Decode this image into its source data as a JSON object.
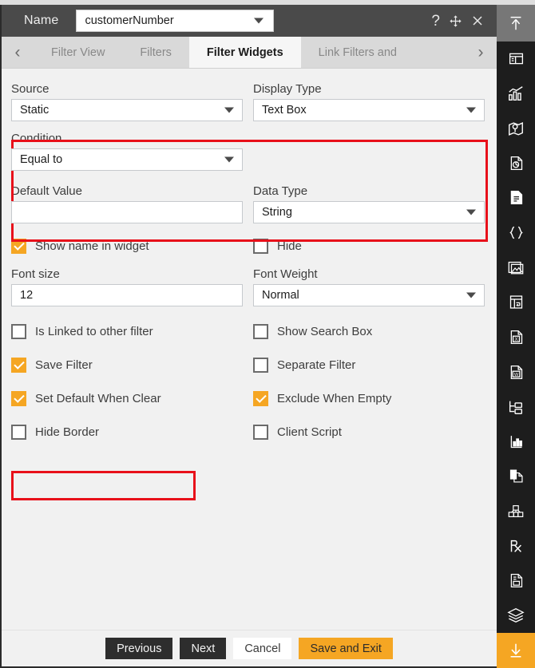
{
  "titlebar": {
    "name_label": "Name",
    "name_value": "customerNumber",
    "help_icon": "question-mark-icon",
    "move_icon": "move-cross-icon",
    "close_icon": "close-icon"
  },
  "tabbar": {
    "prev_arrow": "‹",
    "next_arrow": "›",
    "tabs": [
      {
        "label": "Filter View",
        "active": false
      },
      {
        "label": "Filters",
        "active": false
      },
      {
        "label": "Filter Widgets",
        "active": true
      },
      {
        "label": "Link Filters and",
        "active": false
      }
    ]
  },
  "form": {
    "source": {
      "label": "Source",
      "value": "Static"
    },
    "display_type": {
      "label": "Display Type",
      "value": "Text Box"
    },
    "condition": {
      "label": "Condition",
      "value": "Equal to"
    },
    "default_value": {
      "label": "Default Value",
      "value": "",
      "placeholder": ""
    },
    "data_type": {
      "label": "Data Type",
      "value": "String"
    },
    "font_size": {
      "label": "Font size",
      "value": "12"
    },
    "font_weight": {
      "label": "Font Weight",
      "value": "Normal"
    },
    "checkboxes": [
      {
        "label": "Show name in widget",
        "checked": true,
        "column": "left"
      },
      {
        "label": "Hide",
        "checked": false,
        "column": "right"
      },
      {
        "label": "Is Linked to other filter",
        "checked": false,
        "column": "left"
      },
      {
        "label": "Show Search Box",
        "checked": false,
        "column": "right"
      },
      {
        "label": "Save Filter",
        "checked": true,
        "column": "left"
      },
      {
        "label": "Separate Filter",
        "checked": false,
        "column": "right"
      },
      {
        "label": "Set Default When Clear",
        "checked": true,
        "column": "left"
      },
      {
        "label": "Exclude When Empty",
        "checked": true,
        "column": "right"
      },
      {
        "label": "Hide Border",
        "checked": false,
        "column": "left"
      },
      {
        "label": "Client Script",
        "checked": false,
        "column": "right"
      }
    ]
  },
  "footer": {
    "previous": "Previous",
    "next": "Next",
    "cancel": "Cancel",
    "save_and_exit": "Save and Exit"
  },
  "sidebar": {
    "items": [
      {
        "name": "collapse-up-arrow-icon"
      },
      {
        "name": "dashboard-panel-icon"
      },
      {
        "name": "bar-chart-icon"
      },
      {
        "name": "map-pin-icon"
      },
      {
        "name": "pie-chart-document-icon"
      },
      {
        "name": "document-text-icon"
      },
      {
        "name": "curly-braces-icon"
      },
      {
        "name": "image-gallery-icon"
      },
      {
        "name": "table-grid-icon"
      },
      {
        "name": "excel-file-icon"
      },
      {
        "name": "word-file-icon"
      },
      {
        "name": "tree-folder-icon"
      },
      {
        "name": "chart-axis-icon"
      },
      {
        "name": "copy-pages-icon"
      },
      {
        "name": "cubes-icon"
      },
      {
        "name": "rx-prescription-icon"
      },
      {
        "name": "report-document-icon"
      },
      {
        "name": "layers-stack-icon"
      },
      {
        "name": "download-arrow-icon"
      }
    ]
  },
  "colors": {
    "accent_orange": "#f5a623",
    "highlight_red": "#e8101a",
    "titlebar_gray": "#4a4a4a",
    "sidebar_dark": "#1d1d1d",
    "body_gray": "#f1f1f1"
  }
}
